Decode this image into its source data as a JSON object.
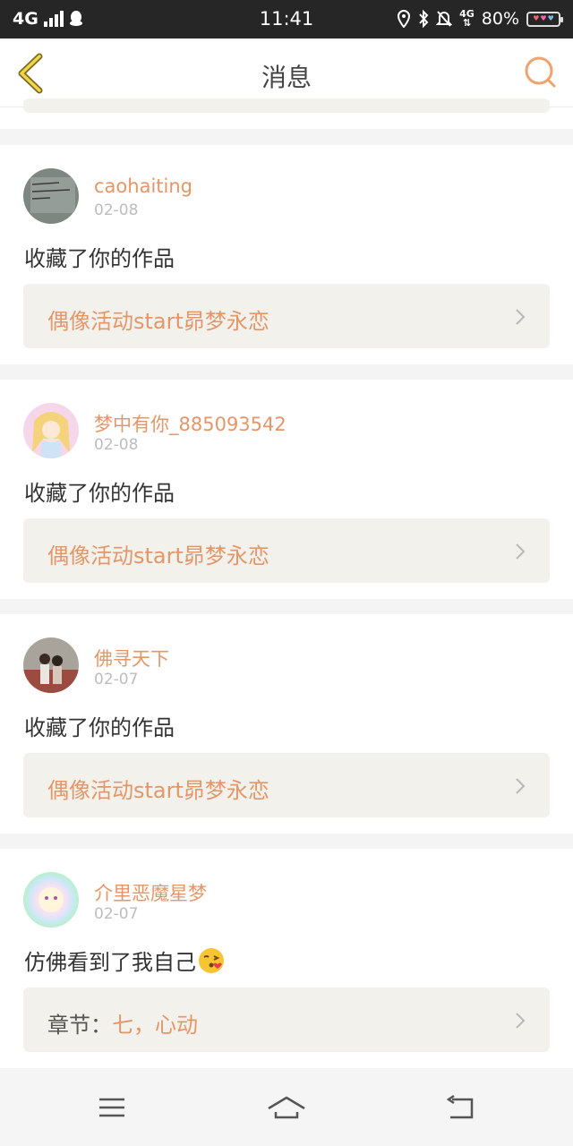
{
  "statusbar": {
    "network": "4G",
    "time": "11:41",
    "data_type": "4G",
    "battery": "80%",
    "icons": [
      "signal-icon",
      "qq-icon",
      "location-icon",
      "bluetooth-icon",
      "mute-bell-icon",
      "data-arrows-icon",
      "battery-icon"
    ]
  },
  "header": {
    "title": "消息",
    "back_icon": "chevron-left-icon",
    "search_icon": "search-icon",
    "accent_color": "#e39769"
  },
  "messages": [
    {
      "username": "caohaiting",
      "date": "02-08",
      "text": "收藏了你的作品",
      "ref_label": "",
      "ref_title": "偶像活动start昴梦永恋"
    },
    {
      "username": "梦中有你_885093542",
      "date": "02-08",
      "text": "收藏了你的作品",
      "ref_label": "",
      "ref_title": "偶像活动start昴梦永恋"
    },
    {
      "username": "佛寻天下",
      "date": "02-07",
      "text": "收藏了你的作品",
      "ref_label": "",
      "ref_title": "偶像活动start昴梦永恋"
    },
    {
      "username": "介里恶魔星梦",
      "date": "02-07",
      "text": "仿佛看到了我自己",
      "emoji": "kiss-face-emoji",
      "ref_label": "章节：",
      "ref_title": "七，心动"
    }
  ],
  "navbar": {
    "icons": [
      "menu-icon",
      "home-icon",
      "back-icon"
    ]
  }
}
